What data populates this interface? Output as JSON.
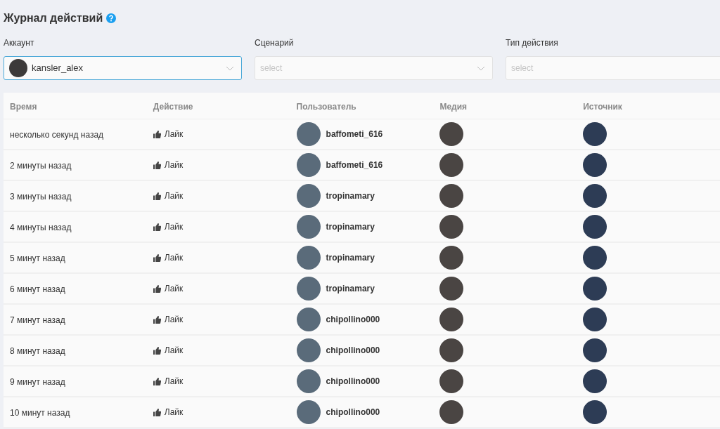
{
  "title": "Журнал действий",
  "filters": [
    {
      "label": "Аккаунт",
      "value": "kansler_alex",
      "focused": true,
      "caret": true
    },
    {
      "label": "Сценарий",
      "placeholder": "select",
      "focused": false,
      "caret": true
    },
    {
      "label": "Тип действия",
      "placeholder": "select",
      "focused": false
    }
  ],
  "table": {
    "columns": [
      "Время",
      "Действие",
      "Пользователь",
      "Медия",
      "Источник"
    ],
    "rows": [
      {
        "time": "несколько секунд назад",
        "action": "Лайк",
        "user": "baffometi_616"
      },
      {
        "time": "2 минуты назад",
        "action": "Лайк",
        "user": "baffometi_616"
      },
      {
        "time": "3 минуты назад",
        "action": "Лайк",
        "user": "tropinamary"
      },
      {
        "time": "4 минуты назад",
        "action": "Лайк",
        "user": "tropinamary"
      },
      {
        "time": "5 минут назад",
        "action": "Лайк",
        "user": "tropinamary"
      },
      {
        "time": "6 минут назад",
        "action": "Лайк",
        "user": "tropinamary"
      },
      {
        "time": "7 минут назад",
        "action": "Лайк",
        "user": "chipollino000"
      },
      {
        "time": "8 минут назад",
        "action": "Лайк",
        "user": "chipollino000"
      },
      {
        "time": "9 минут назад",
        "action": "Лайк",
        "user": "chipollino000"
      },
      {
        "time": "10 минут назад",
        "action": "Лайк",
        "user": "chipollino000"
      }
    ]
  }
}
